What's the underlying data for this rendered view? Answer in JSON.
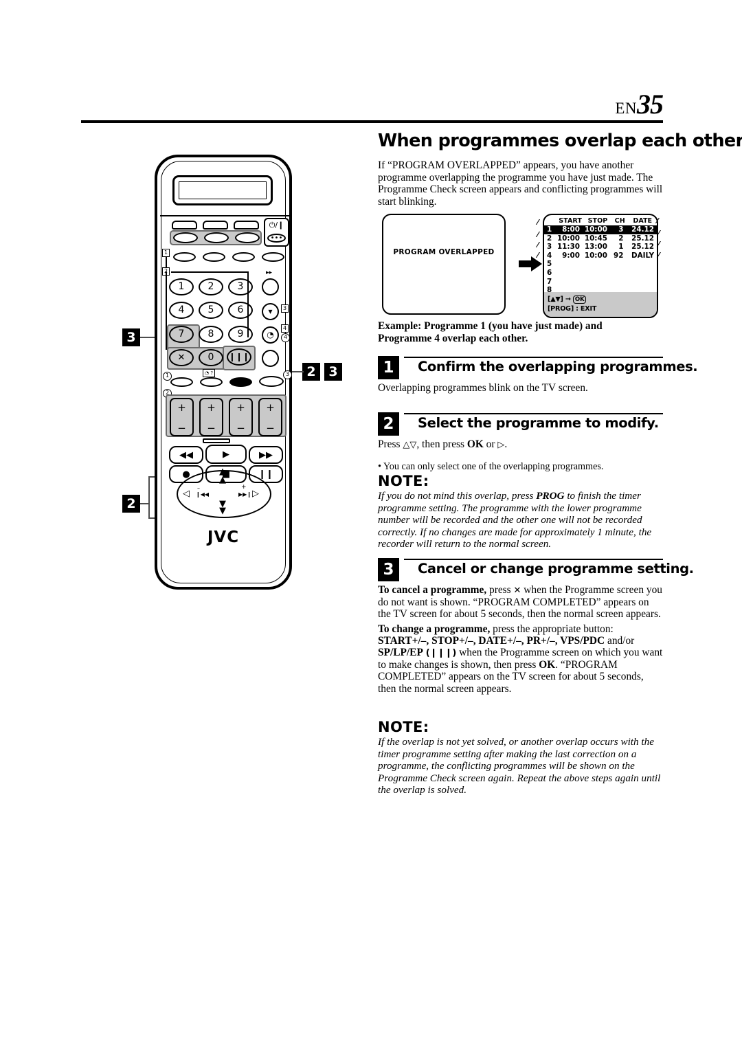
{
  "header": {
    "lang_code": "EN",
    "page_number": "35"
  },
  "section": {
    "title": "When programmes overlap each other",
    "intro": "If “PROGRAM OVERLAPPED” appears, you have another programme overlapping the programme you have just made. The Programme Check screen appears and conflicting programmes will start blinking."
  },
  "screens": {
    "left": {
      "message": "PROGRAM OVERLAPPED"
    },
    "arrow_icon": "right-arrow-icon",
    "right": {
      "columns": [
        "START",
        "STOP",
        "CH",
        "DATE"
      ],
      "rows": [
        {
          "index": "1",
          "start": "8:00",
          "stop": "10:00",
          "ch": "3",
          "date": "24.12",
          "selected": true,
          "blinking": true
        },
        {
          "index": "2",
          "start": "10:00",
          "stop": "10:45",
          "ch": "2",
          "date": "25.12",
          "selected": false,
          "blinking": true
        },
        {
          "index": "3",
          "start": "11:30",
          "stop": "13:00",
          "ch": "1",
          "date": "25.12",
          "selected": false,
          "blinking": true
        },
        {
          "index": "4",
          "start": "9:00",
          "stop": "10:00",
          "ch": "92",
          "date": "DAILY",
          "selected": false,
          "blinking": true
        },
        {
          "index": "5",
          "start": "",
          "stop": "",
          "ch": "",
          "date": "",
          "selected": false,
          "blinking": false
        },
        {
          "index": "6",
          "start": "",
          "stop": "",
          "ch": "",
          "date": "",
          "selected": false,
          "blinking": false
        },
        {
          "index": "7",
          "start": "",
          "stop": "",
          "ch": "",
          "date": "",
          "selected": false,
          "blinking": false
        },
        {
          "index": "8",
          "start": "",
          "stop": "",
          "ch": "",
          "date": "",
          "selected": false,
          "blinking": false
        }
      ],
      "footer_line1_prefix": "[",
      "footer_line1_arrows": "▲▼",
      "footer_line1_mid": "] →",
      "footer_line1_ok": "OK",
      "footer_line2": "[PROG] : EXIT"
    }
  },
  "example": {
    "line1": "Example: Programme 1 (you have just made) and",
    "line2": "Programme 4 overlap each other."
  },
  "steps": [
    {
      "number": "1",
      "title": "Confirm the overlapping programmes.",
      "body": "Overlapping programmes blink on the TV screen."
    },
    {
      "number": "2",
      "title": "Select the programme to modify.",
      "body_prefix": "Press ",
      "body_arrows": "△▽",
      "body_mid": ", then press ",
      "body_ok": "OK",
      "body_or": " or ",
      "body_right": "▷",
      "body_end": ".",
      "bullet": "• You can only select one of the overlapping programmes."
    },
    {
      "number": "3",
      "title": "Cancel or change programme setting."
    }
  ],
  "notes": [
    {
      "title": "NOTE:",
      "text_a": "If you do not mind this overlap, press ",
      "bold_a": "PROG",
      "text_b": " to finish the timer programme setting. The programme with the lower programme number will be recorded and the other one will not be recorded correctly. If no changes are made for approximately 1 minute, the recorder will return to the normal screen."
    },
    {
      "title": "NOTE:",
      "text_a": "If the overlap is not yet solved, or another overlap occurs with the timer programme setting after making the last correction on a programme, the conflicting programmes will be shown on the Programme Check screen again. Repeat the above steps again until the overlap is solved."
    }
  ],
  "step3_body": {
    "cancel_bold": "To cancel a programme,",
    "cancel_text_1": " press ",
    "cancel_symbol": "✕",
    "cancel_text_2": " when the Programme screen you do not want is shown. “PROGRAM COMPLETED” appears on the TV screen for about 5 seconds, then the normal screen appears.",
    "change_bold": "To change a programme,",
    "change_text_1": " press the appropriate button:",
    "change_buttons": "START+/–, STOP+/–, DATE+/–, PR+/–, VPS/PDC",
    "change_text_2": " and/or",
    "change_sp": "SP/LP/EP",
    "change_sp_sym": "(❙❙❙)",
    "change_text_3": " when the Programme screen on which you want to make changes is shown, then press ",
    "change_ok": "OK",
    "change_text_4": ". “PROGRAM COMPLETED” appears on the TV screen for about 5 seconds, then the normal screen appears."
  },
  "remote": {
    "brand": "JVC",
    "power_label": "⏻/❙",
    "numeric_keys": [
      "1",
      "2",
      "3",
      "4",
      "5",
      "6",
      "7",
      "8",
      "9",
      "0"
    ],
    "cancel_key": "✕",
    "tape_speed_key": "❙❙❙",
    "callouts_on_remote": [
      "1",
      "2",
      "3",
      "4"
    ],
    "step_markers_left": [
      "3",
      "2"
    ],
    "step_markers_right": [
      "2",
      "3"
    ],
    "dpad": {
      "up": "▲",
      "down": "▼",
      "left": "◁",
      "right": "▷",
      "minus": "–",
      "plus": "+",
      "rew": "❙◀◀",
      "ff": "▶▶❙"
    },
    "transport": {
      "rew": "◀◀",
      "play": "▶",
      "ff": "▶▶",
      "rec": "●",
      "stop": "■",
      "pause": "❙❙"
    }
  }
}
